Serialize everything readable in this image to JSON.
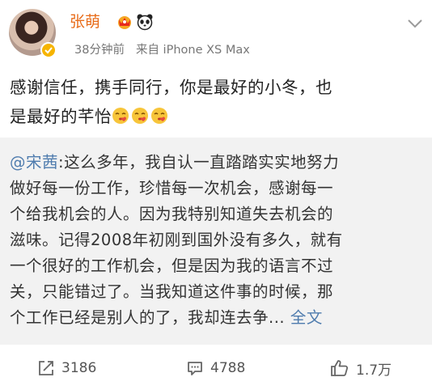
{
  "post": {
    "author": "张萌",
    "time": "38分钟前",
    "source": "来自 iPhone XS Max",
    "text_line1": "感谢信任，携手同行，你是最好的小冬，也",
    "text_line2": "是最好的芊怡",
    "emojis": [
      "kiss-emoji",
      "kiss-emoji",
      "kiss-emoji"
    ]
  },
  "repost": {
    "user": "@宋茜",
    "lines": [
      ":这么多年，我自认一直踏踏实实地努力",
      "做好每一份工作，珍惜每一次机会，感谢每一",
      "个给我机会的人。因为我特别知道失去机会的",
      "滋味。记得2008年初刚到国外没有多久，就有",
      "一个很好的工作机会，但是因为我的语言不过",
      "关，只能错过了。当我知道这件事的时候，那",
      "个工作已经是别人的了，我却连去争..."
    ],
    "full_link": "全文"
  },
  "actions": {
    "share_count": "3186",
    "comment_count": "4788",
    "like_count": "1.7万"
  },
  "colors": {
    "name": "#e86c1a",
    "link": "#4f7cae",
    "repost_bg": "#f2f2f2"
  }
}
